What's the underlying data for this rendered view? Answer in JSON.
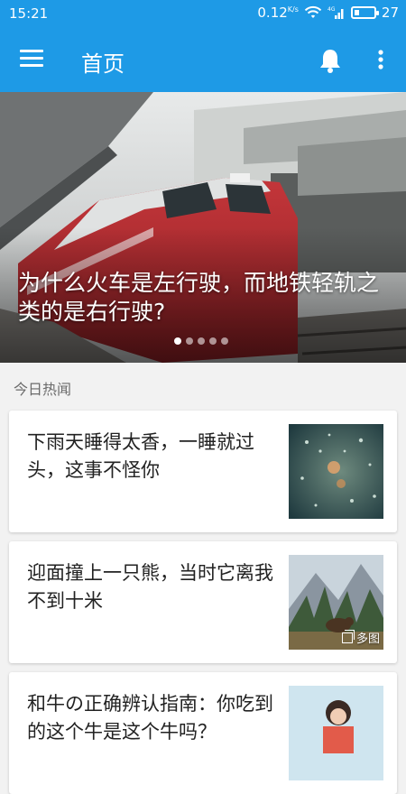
{
  "status_bar": {
    "time": "15:21",
    "net_speed": "0.12",
    "net_speed_unit": "K/s",
    "signal_label": "4G",
    "battery": "27",
    "battery_level": 0.27
  },
  "app_bar": {
    "title": "首页",
    "menu_icon": "menu-icon",
    "notification_icon": "bell-icon",
    "more_icon": "more-vert-icon"
  },
  "banner": {
    "headline": "为什么火车是左行驶，而地铁轻轨之类的是右行驶?",
    "dot_count": 5,
    "active_dot": 0
  },
  "section": {
    "label": "今日热闻"
  },
  "stories": [
    {
      "title": "下雨天睡得太香，一睡就过头，这事不怪你",
      "badge": ""
    },
    {
      "title": "迎面撞上一只熊，当时它离我不到十米",
      "badge": "多图"
    },
    {
      "title": "和牛の正确辨认指南：你吃到的这个牛是这个牛吗？",
      "badge": ""
    }
  ],
  "colors": {
    "primary": "#1e9ae6",
    "background": "#f2f2f2"
  }
}
